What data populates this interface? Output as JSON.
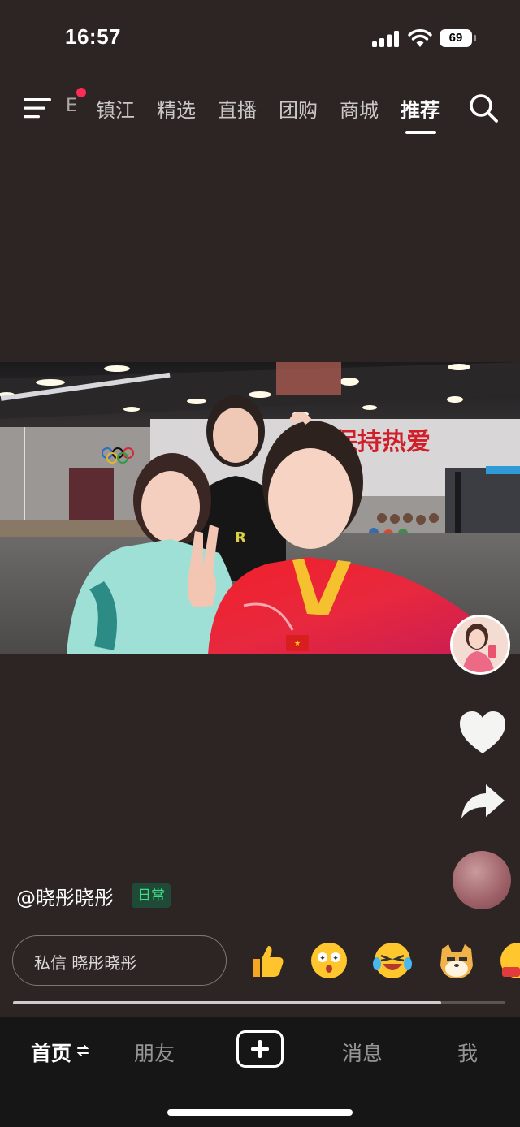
{
  "status_bar": {
    "time": "16:57",
    "battery": "69"
  },
  "top_nav": {
    "partial_tab": "E",
    "tabs": [
      {
        "label": "镇江",
        "active": false
      },
      {
        "label": "精选",
        "active": false
      },
      {
        "label": "直播",
        "active": false
      },
      {
        "label": "团购",
        "active": false
      },
      {
        "label": "商城",
        "active": false
      },
      {
        "label": "推荐",
        "active": true
      }
    ],
    "notification_dot_color": "#fe2c55"
  },
  "photo": {
    "banner_text": "保持热爱"
  },
  "video": {
    "author": "@晓彤晓彤",
    "tag": "日常",
    "tag_color": "#3fdd86",
    "progress": 0.87
  },
  "actions": [
    "like-icon",
    "share-icon",
    "music-disc-icon"
  ],
  "message_bar": {
    "placeholder": "私信 晓彤晓彤",
    "emoji": [
      "thumbs-up-emoji",
      "star-eyes-emoji",
      "laugh-cry-emoji",
      "doge-emoji",
      "partial-emoji"
    ]
  },
  "bottom_nav": {
    "items": [
      {
        "label": "首页",
        "active": true
      },
      {
        "label": "朋友",
        "active": false
      },
      {
        "label": "消息",
        "active": false
      },
      {
        "label": "我",
        "active": false
      }
    ]
  }
}
